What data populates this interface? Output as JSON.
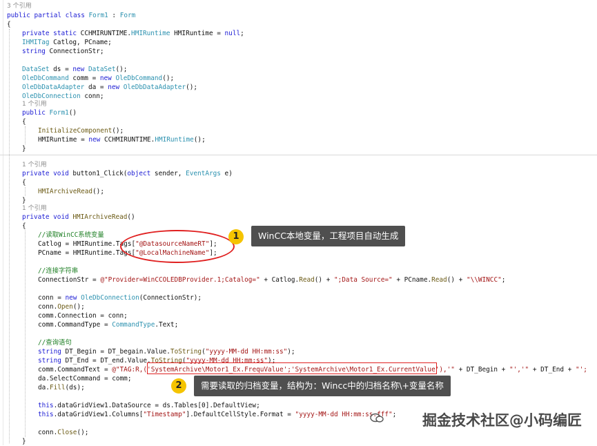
{
  "code": {
    "ref3": "3 个引用",
    "ref1": "1 个引用",
    "l_class": "public partial class Form1 : Form",
    "brace_open": "{",
    "brace_close": "}",
    "l_field1": "private static CCHMIRUNTIME.HMIRuntime HMIRuntime = null;",
    "l_field2": "IHMITag Catlog, PCname;",
    "l_field3": "string ConnectionStr;",
    "l_field4": "DataSet ds = new DataSet();",
    "l_field5": "OleDbCommand comm = new OleDbCommand();",
    "l_field6": "OleDbDataAdapter da = new OleDbDataAdapter();",
    "l_field7": "OleDbConnection conn;",
    "l_ctor": "public Form1()",
    "l_init": "InitializeComponent();",
    "l_runtime": "HMIRuntime = new CCHMIRUNTIME.HMIRuntime();",
    "l_click": "private void button1_Click(object sender, EventArgs e)",
    "l_call": "HMIArchiveRead();",
    "l_method": "private void HMIArchiveRead()",
    "c_read": "//读取WinCC系统变量",
    "l_catlog": "Catlog = HMIRuntime.Tags[\"@DatasourceNameRT\"];",
    "l_pcname": "PCname = HMIRuntime.Tags[\"@LocalMachineName\"];",
    "c_conn": "//连接字符串",
    "l_connstr": "ConnectionStr = @\"Provider=WinCCOLEDBProvider.1;Catalog=\" + Catlog.Read() + \";Data Source=\" + PCname.Read() + \"\\\\WINCC\";",
    "l_conn_new": "conn = new OleDbConnection(ConnectionStr);",
    "l_conn_open": "conn.Open();",
    "l_comm_conn": "comm.Connection = conn;",
    "l_comm_type": "comm.CommandType = CommandType.Text;",
    "c_query": "//查询语句",
    "l_dtb": "string DT_Begin = DT_begain.Value.ToString(\"yyyy-MM-dd HH:mm:ss\");",
    "l_dte": "string DT_End = DT_end.Value.ToString(\"yyyy-MM-dd HH:mm:ss\");",
    "l_cmdtext": "comm.CommandText = @\"TAG:R,('SystemArchive\\Motor1_Ex.FrequValue';'SystemArchive\\Motor1_Ex.CurrentValue'),'\" + DT_Begin + \"','\" + DT_End + \"';",
    "l_select": "da.SelectCommand = comm;",
    "l_fill": "da.Fill(ds);",
    "l_ds": "this.dataGridView1.DataSource = ds.Tables[0].DefaultView;",
    "l_fmt": "this.dataGridView1.Columns[\"Timestamp\"].DefaultCellStyle.Format = \"yyyy-MM-dd HH:mm:ss.fff\";",
    "l_close": "conn.Close();"
  },
  "annotations": {
    "marker1": "1",
    "marker2": "2",
    "callout1": "WinCC本地变量，工程项目自动生成",
    "callout2": "需要读取的归档变量，结构为：Wincc中的归档名称\\+变量名称"
  },
  "watermark": "掘金技术社区@小码编匠",
  "colors": {
    "keyword": "#1b1bd4",
    "type": "#2b91af",
    "string": "#a31515",
    "comment": "#1e7f24",
    "highlight": "#e02020",
    "marker": "#f5c400",
    "callout_bg": "#4f4f4f"
  }
}
